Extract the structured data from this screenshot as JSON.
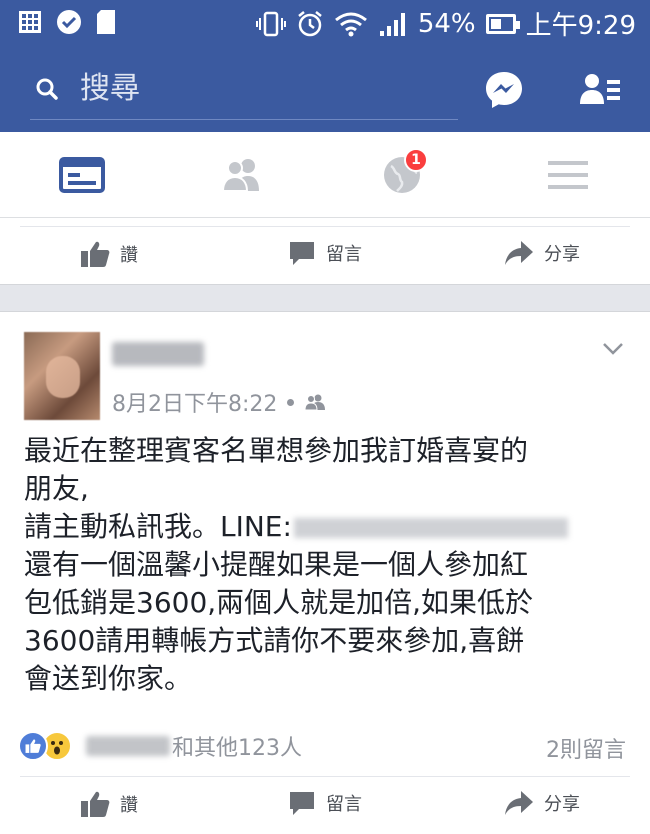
{
  "status_bar": {
    "battery": "54%",
    "battery_level": 0.54,
    "time": "上午9:29",
    "icons": [
      "calendar-grid-icon",
      "check-circle-icon",
      "sd-card-icon",
      "vibrate-icon",
      "alarm-icon",
      "wifi-icon",
      "signal-icon",
      "battery-icon"
    ]
  },
  "header": {
    "search_placeholder": "搜尋",
    "icons": [
      "search-icon",
      "messenger-icon",
      "friend-requests-icon"
    ],
    "color": "#3b5aa0"
  },
  "tabs": {
    "items": [
      "news-feed-icon",
      "friends-icon",
      "notifications-globe-icon",
      "menu-icon"
    ],
    "active_color": "#3b5aa0",
    "notification_badge": "1"
  },
  "actions": {
    "like": "讚",
    "comment": "留言",
    "share": "分享"
  },
  "post": {
    "timestamp": "8月2日下午8:22",
    "lines": [
      "最近在整理賓客名單想參加我訂婚喜宴的",
      "朋友,",
      "請主動私訊我。LINE:",
      "還有一個溫馨小提醒如果是一個人參加紅",
      "包低銷是3600,兩個人就是加倍,如果低於",
      "3600請用轉帳方式請你不要來參加,喜餅",
      "會送到你家。"
    ],
    "reactions_suffix": "和其他123人",
    "comments_count": "2則留言"
  }
}
